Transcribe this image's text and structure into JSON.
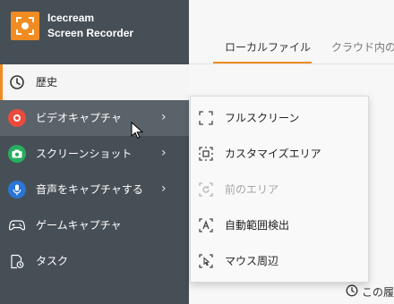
{
  "app": {
    "brand_line1": "Icecream",
    "brand_line2": "Screen Recorder",
    "accent_color": "#f08c21",
    "sidebar_color": "#474f56"
  },
  "sidebar": {
    "items": [
      {
        "label": "歴史",
        "icon": "clock-icon",
        "state": "selected"
      },
      {
        "label": "ビデオキャプチャ",
        "icon": "record-icon",
        "has_submenu": true,
        "state": "hovered"
      },
      {
        "label": "スクリーンショット",
        "icon": "camera-icon",
        "has_submenu": true
      },
      {
        "label": "音声をキャプチャする",
        "icon": "microphone-icon",
        "has_submenu": true
      },
      {
        "label": "ゲームキャプチャ",
        "icon": "gamepad-icon"
      },
      {
        "label": "タスク",
        "icon": "task-icon"
      }
    ],
    "arrow": "›"
  },
  "tabs": [
    {
      "label": "ローカルファイル",
      "active": true
    },
    {
      "label": "クラウド内のフ",
      "active": false
    }
  ],
  "bottom_hint": "この履",
  "submenu": {
    "items": [
      {
        "label": "フルスクリーン",
        "icon": "fullscreen-icon",
        "enabled": true
      },
      {
        "label": "カスタマイズエリア",
        "icon": "custom-area-icon",
        "enabled": true
      },
      {
        "label": "前のエリア",
        "icon": "previous-area-icon",
        "enabled": false
      },
      {
        "label": "自動範囲検出",
        "icon": "auto-detect-icon",
        "enabled": true
      },
      {
        "label": "マウス周辺",
        "icon": "around-mouse-icon",
        "enabled": true
      }
    ]
  }
}
